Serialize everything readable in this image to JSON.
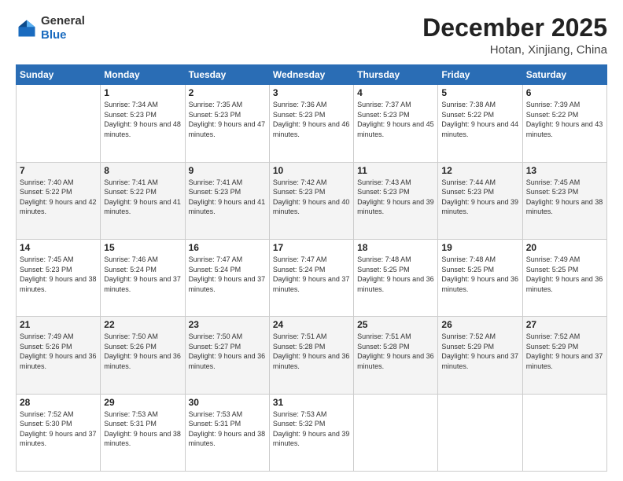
{
  "header": {
    "logo_line1": "General",
    "logo_line2": "Blue",
    "month": "December 2025",
    "location": "Hotan, Xinjiang, China"
  },
  "weekdays": [
    "Sunday",
    "Monday",
    "Tuesday",
    "Wednesday",
    "Thursday",
    "Friday",
    "Saturday"
  ],
  "weeks": [
    [
      {
        "day": "",
        "sunrise": "",
        "sunset": "",
        "daylight": ""
      },
      {
        "day": "1",
        "sunrise": "7:34 AM",
        "sunset": "5:23 PM",
        "daylight": "9 hours and 48 minutes."
      },
      {
        "day": "2",
        "sunrise": "7:35 AM",
        "sunset": "5:23 PM",
        "daylight": "9 hours and 47 minutes."
      },
      {
        "day": "3",
        "sunrise": "7:36 AM",
        "sunset": "5:23 PM",
        "daylight": "9 hours and 46 minutes."
      },
      {
        "day": "4",
        "sunrise": "7:37 AM",
        "sunset": "5:23 PM",
        "daylight": "9 hours and 45 minutes."
      },
      {
        "day": "5",
        "sunrise": "7:38 AM",
        "sunset": "5:22 PM",
        "daylight": "9 hours and 44 minutes."
      },
      {
        "day": "6",
        "sunrise": "7:39 AM",
        "sunset": "5:22 PM",
        "daylight": "9 hours and 43 minutes."
      }
    ],
    [
      {
        "day": "7",
        "sunrise": "7:40 AM",
        "sunset": "5:22 PM",
        "daylight": "9 hours and 42 minutes."
      },
      {
        "day": "8",
        "sunrise": "7:41 AM",
        "sunset": "5:22 PM",
        "daylight": "9 hours and 41 minutes."
      },
      {
        "day": "9",
        "sunrise": "7:41 AM",
        "sunset": "5:23 PM",
        "daylight": "9 hours and 41 minutes."
      },
      {
        "day": "10",
        "sunrise": "7:42 AM",
        "sunset": "5:23 PM",
        "daylight": "9 hours and 40 minutes."
      },
      {
        "day": "11",
        "sunrise": "7:43 AM",
        "sunset": "5:23 PM",
        "daylight": "9 hours and 39 minutes."
      },
      {
        "day": "12",
        "sunrise": "7:44 AM",
        "sunset": "5:23 PM",
        "daylight": "9 hours and 39 minutes."
      },
      {
        "day": "13",
        "sunrise": "7:45 AM",
        "sunset": "5:23 PM",
        "daylight": "9 hours and 38 minutes."
      }
    ],
    [
      {
        "day": "14",
        "sunrise": "7:45 AM",
        "sunset": "5:23 PM",
        "daylight": "9 hours and 38 minutes."
      },
      {
        "day": "15",
        "sunrise": "7:46 AM",
        "sunset": "5:24 PM",
        "daylight": "9 hours and 37 minutes."
      },
      {
        "day": "16",
        "sunrise": "7:47 AM",
        "sunset": "5:24 PM",
        "daylight": "9 hours and 37 minutes."
      },
      {
        "day": "17",
        "sunrise": "7:47 AM",
        "sunset": "5:24 PM",
        "daylight": "9 hours and 37 minutes."
      },
      {
        "day": "18",
        "sunrise": "7:48 AM",
        "sunset": "5:25 PM",
        "daylight": "9 hours and 36 minutes."
      },
      {
        "day": "19",
        "sunrise": "7:48 AM",
        "sunset": "5:25 PM",
        "daylight": "9 hours and 36 minutes."
      },
      {
        "day": "20",
        "sunrise": "7:49 AM",
        "sunset": "5:25 PM",
        "daylight": "9 hours and 36 minutes."
      }
    ],
    [
      {
        "day": "21",
        "sunrise": "7:49 AM",
        "sunset": "5:26 PM",
        "daylight": "9 hours and 36 minutes."
      },
      {
        "day": "22",
        "sunrise": "7:50 AM",
        "sunset": "5:26 PM",
        "daylight": "9 hours and 36 minutes."
      },
      {
        "day": "23",
        "sunrise": "7:50 AM",
        "sunset": "5:27 PM",
        "daylight": "9 hours and 36 minutes."
      },
      {
        "day": "24",
        "sunrise": "7:51 AM",
        "sunset": "5:28 PM",
        "daylight": "9 hours and 36 minutes."
      },
      {
        "day": "25",
        "sunrise": "7:51 AM",
        "sunset": "5:28 PM",
        "daylight": "9 hours and 36 minutes."
      },
      {
        "day": "26",
        "sunrise": "7:52 AM",
        "sunset": "5:29 PM",
        "daylight": "9 hours and 37 minutes."
      },
      {
        "day": "27",
        "sunrise": "7:52 AM",
        "sunset": "5:29 PM",
        "daylight": "9 hours and 37 minutes."
      }
    ],
    [
      {
        "day": "28",
        "sunrise": "7:52 AM",
        "sunset": "5:30 PM",
        "daylight": "9 hours and 37 minutes."
      },
      {
        "day": "29",
        "sunrise": "7:53 AM",
        "sunset": "5:31 PM",
        "daylight": "9 hours and 38 minutes."
      },
      {
        "day": "30",
        "sunrise": "7:53 AM",
        "sunset": "5:31 PM",
        "daylight": "9 hours and 38 minutes."
      },
      {
        "day": "31",
        "sunrise": "7:53 AM",
        "sunset": "5:32 PM",
        "daylight": "9 hours and 39 minutes."
      },
      {
        "day": "",
        "sunrise": "",
        "sunset": "",
        "daylight": ""
      },
      {
        "day": "",
        "sunrise": "",
        "sunset": "",
        "daylight": ""
      },
      {
        "day": "",
        "sunrise": "",
        "sunset": "",
        "daylight": ""
      }
    ]
  ]
}
